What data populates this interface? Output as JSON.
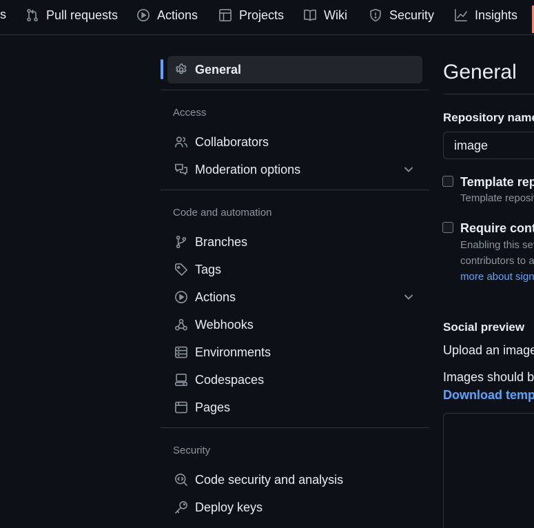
{
  "topnav": {
    "fragment": "s",
    "tabs": [
      {
        "label": "Pull requests",
        "icon": "pull-request-icon"
      },
      {
        "label": "Actions",
        "icon": "play-icon"
      },
      {
        "label": "Projects",
        "icon": "table-icon"
      },
      {
        "label": "Wiki",
        "icon": "book-icon"
      },
      {
        "label": "Security",
        "icon": "shield-icon"
      },
      {
        "label": "Insights",
        "icon": "graph-icon"
      }
    ]
  },
  "sidebar": {
    "general": {
      "label": "General",
      "icon": "gear-icon"
    },
    "sections": [
      {
        "heading": "Access",
        "items": [
          {
            "label": "Collaborators",
            "icon": "people-icon"
          },
          {
            "label": "Moderation options",
            "icon": "comment-discussion-icon",
            "expandable": true
          }
        ]
      },
      {
        "heading": "Code and automation",
        "items": [
          {
            "label": "Branches",
            "icon": "git-branch-icon"
          },
          {
            "label": "Tags",
            "icon": "tag-icon"
          },
          {
            "label": "Actions",
            "icon": "play-icon",
            "expandable": true
          },
          {
            "label": "Webhooks",
            "icon": "webhook-icon"
          },
          {
            "label": "Environments",
            "icon": "server-icon"
          },
          {
            "label": "Codespaces",
            "icon": "codespaces-icon"
          },
          {
            "label": "Pages",
            "icon": "browser-icon"
          }
        ]
      },
      {
        "heading": "Security",
        "items": [
          {
            "label": "Code security and analysis",
            "icon": "codescan-icon"
          },
          {
            "label": "Deploy keys",
            "icon": "key-icon"
          }
        ]
      }
    ]
  },
  "main": {
    "title": "General",
    "repo_name_label": "Repository name",
    "repo_name_value": "image",
    "template_repo": {
      "title": "Template repo",
      "desc": "Template reposit",
      "checked": false
    },
    "require_contrib": {
      "title": "Require contr",
      "desc_line1": "Enabling this set",
      "desc_line2": "contributors to a",
      "link": "more about sign",
      "checked": false
    },
    "social_preview": {
      "heading": "Social preview",
      "line1": "Upload an image",
      "line2": "Images should be",
      "download_link": "Download templ"
    }
  },
  "colors": {
    "background": "#0d1117",
    "text": "#e6edf3",
    "muted": "#8b949e",
    "accent": "#58a6ff",
    "border": "#30363d",
    "active_bg": "#21262d"
  }
}
